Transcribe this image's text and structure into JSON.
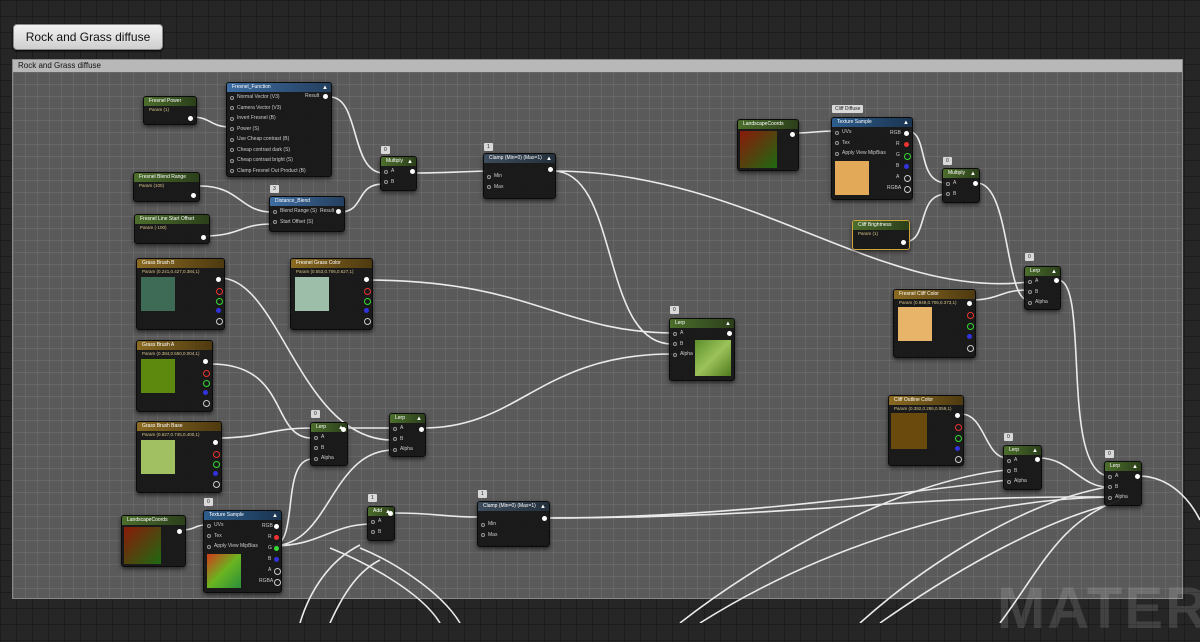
{
  "graph": {
    "title_button": "Rock and Grass diffuse",
    "comment_title": "Rock and Grass diffuse",
    "watermark": "MATERIAL"
  },
  "colors": {
    "param_green": "#4c6e2c",
    "vector_gold": "#8a6a22",
    "texture_blue": "#2d5d8c",
    "comment_header": "#b8b8b8"
  },
  "nodes": {
    "fresnel_power": {
      "title": "Fresnel Power",
      "sub": "Param (1)"
    },
    "fresnel_function": {
      "title": "Fresnel_Function",
      "inputs": [
        "Normal Vector (V3)",
        "Camera Vector (V3)",
        "Invert Fresnel (B)",
        "Power (S)",
        "Use Cheap contrast (B)",
        "Cheap contrast dark (S)",
        "Cheap contrast bright (S)",
        "Clamp Fresnel Out Product (B)"
      ],
      "output": "Result"
    },
    "multiply_1": {
      "title": "Multiply",
      "tag": "0",
      "inputs": [
        "A",
        "B"
      ]
    },
    "clamp_1": {
      "title": "Clamp (Min=0) (Max=1)",
      "tag": "1",
      "inputs": [
        "Min",
        "Max"
      ]
    },
    "fresnel_blend_range": {
      "title": "Fresnel Blend Range",
      "sub": "Param (100)"
    },
    "fresnel_line_start_offset": {
      "title": "Fresnel Line Start Offset",
      "sub": "Param (-100)"
    },
    "distance_blend": {
      "title": "Distance_Blend",
      "tag": "3",
      "inputs": [
        "Blend Range (S)",
        "Start Offset (S)"
      ],
      "output": "Result"
    },
    "grass_brush_b": {
      "title": "Grass Brush B",
      "sub": "Param (0.241,0.427,0.384,1)"
    },
    "fresnel_grass_color": {
      "title": "Fresnel Grass Color",
      "sub": "Param (0.553,0.706,0.627,1)"
    },
    "grass_brush_a": {
      "title": "Grass Brush A",
      "sub": "Param (0.384,0.550,0.004,1)"
    },
    "grass_brush_base": {
      "title": "Grass Brush Base",
      "sub": "Param (0.627,0.745,0.400,1)"
    },
    "landscape_coords_bottom": {
      "title": "LandscapeCoords"
    },
    "texture_sample_bottom": {
      "title": "Texture Sample",
      "tag": "0",
      "inputs": [
        "UVs",
        "Tex",
        "Apply View MipBias"
      ],
      "outputs": [
        "RGB",
        "R",
        "G",
        "B",
        "A",
        "RGBA"
      ]
    },
    "lerp_1": {
      "title": "Lerp",
      "tag": "0",
      "inputs": [
        "A",
        "B",
        "Alpha"
      ]
    },
    "lerp_2": {
      "title": "Lerp",
      "inputs": [
        "A",
        "B",
        "Alpha"
      ]
    },
    "add_1": {
      "title": "Add",
      "tag": "1",
      "inputs": [
        "A",
        "B"
      ]
    },
    "clamp_2": {
      "title": "Clamp (Min=0) (Max=1)",
      "tag": "1",
      "inputs": [
        "Min",
        "Max"
      ]
    },
    "lerp_center": {
      "title": "Lerp",
      "tag": "0",
      "inputs": [
        "A",
        "B",
        "Alpha"
      ]
    },
    "landscape_coords_top": {
      "title": "LandscapeCoords"
    },
    "cliff_diffuse_tag": "Cliff Diffuse",
    "texture_sample_top": {
      "title": "Texture Sample",
      "inputs": [
        "UVs",
        "Tex",
        "Apply View MipBias"
      ],
      "outputs": [
        "RGB",
        "R",
        "G",
        "B",
        "A",
        "RGBA"
      ]
    },
    "multiply_2": {
      "title": "Multiply",
      "tag": "0",
      "inputs": [
        "A",
        "B"
      ]
    },
    "cliff_brightness": {
      "title": "Cliff Brightness",
      "sub": "Param (1)"
    },
    "fresnel_cliff_color": {
      "title": "Fresnel Cliff Color",
      "sub": "Param (0.949,0.706,0.373,1)"
    },
    "lerp_right_1": {
      "title": "Lerp",
      "tag": "0",
      "inputs": [
        "A",
        "B",
        "Alpha"
      ]
    },
    "cliff_outline_color": {
      "title": "Cliff Outline Color",
      "sub": "Param (0.392,0.286,0.059,1)"
    },
    "lerp_right_2": {
      "title": "Lerp",
      "tag": "0",
      "inputs": [
        "A",
        "B",
        "Alpha"
      ]
    },
    "lerp_right_3": {
      "title": "Lerp",
      "tag": "0",
      "inputs": [
        "A",
        "B",
        "Alpha"
      ]
    }
  }
}
